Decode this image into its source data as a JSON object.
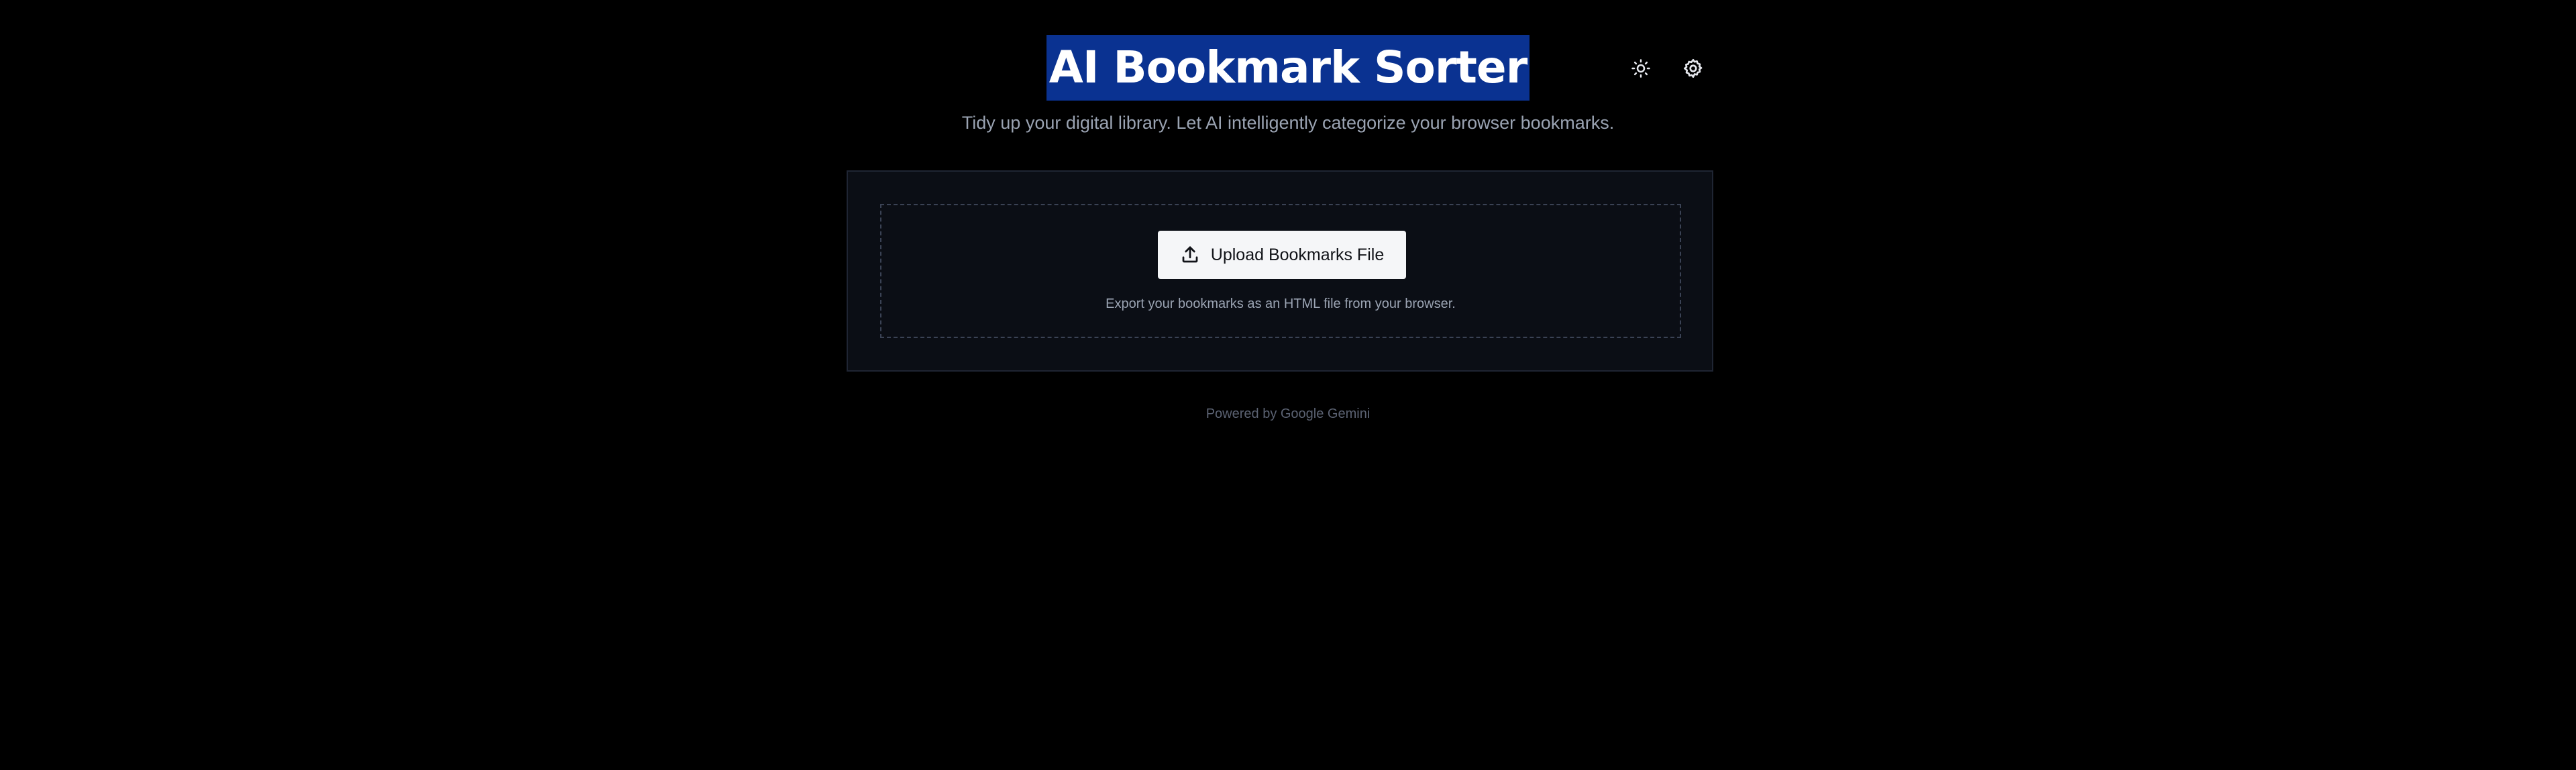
{
  "header": {
    "title": "AI Bookmark Sorter",
    "subtitle": "Tidy up your digital library. Let AI intelligently categorize your browser bookmarks.",
    "icons": [
      "sun-icon",
      "gear-icon"
    ]
  },
  "upload": {
    "button_label": "Upload Bookmarks File",
    "button_icon": "upload-icon",
    "hint": "Export your bookmarks as an HTML file from your browser."
  },
  "footer": {
    "text": "Powered by Google Gemini"
  },
  "colors": {
    "background": "#000000",
    "title_highlight": "#0a3291",
    "card_background": "#0b0e15",
    "button_background": "#f5f6f8"
  }
}
